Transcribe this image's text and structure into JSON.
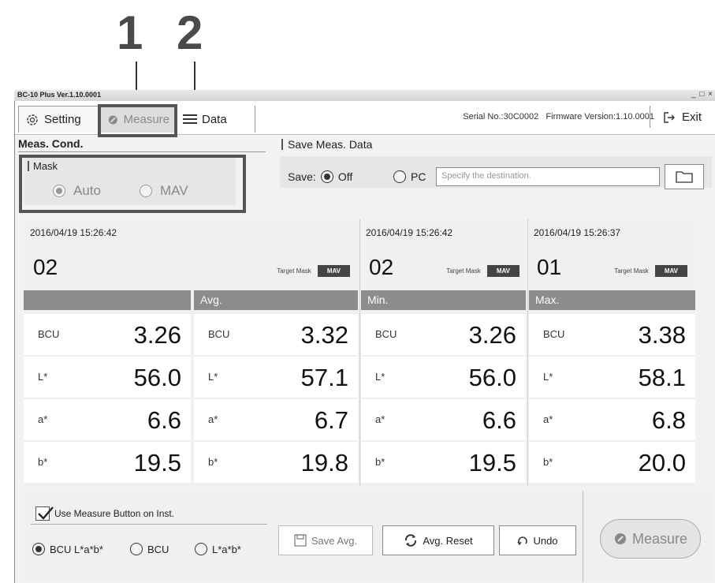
{
  "callouts": [
    "1",
    "2"
  ],
  "window": {
    "title": "BC-10 Plus Ver.1.10.0001",
    "controls": "_ □ ×"
  },
  "toolbar": {
    "setting_label": "Setting",
    "measure_label": "Measure",
    "data_label": "Data",
    "serial": "Serial No.:30C0002",
    "firmware": "Firmware Version:1.10.0001",
    "exit_label": "Exit"
  },
  "meas_cond": {
    "title": "Meas. Cond.",
    "mask_label": "Mask",
    "options": [
      "Auto",
      "MAV"
    ],
    "selected": "Auto"
  },
  "save_data": {
    "title": "Save Meas. Data",
    "save_label": "Save:",
    "off_label": "Off",
    "pc_label": "PC",
    "dest_placeholder": "Specify the destination.",
    "selected": "Off"
  },
  "columns": [
    {
      "timestamp": "2016/04/19 15:26:42",
      "number": "02",
      "target_label": "Target Mask",
      "target_value": "MAV",
      "header": "",
      "rows": [
        {
          "label": "BCU",
          "value": "3.26"
        },
        {
          "label": "L*",
          "value": "56.0"
        },
        {
          "label": "a*",
          "value": "6.6"
        },
        {
          "label": "b*",
          "value": "19.5"
        }
      ]
    },
    {
      "header": "Avg.",
      "rows": [
        {
          "label": "BCU",
          "value": "3.32"
        },
        {
          "label": "L*",
          "value": "57.1"
        },
        {
          "label": "a*",
          "value": "6.7"
        },
        {
          "label": "b*",
          "value": "19.8"
        }
      ]
    },
    {
      "timestamp": "2016/04/19 15:26:42",
      "number": "02",
      "target_label": "Target Mask",
      "target_value": "MAV",
      "header": "Min.",
      "rows": [
        {
          "label": "BCU",
          "value": "3.26"
        },
        {
          "label": "L*",
          "value": "56.0"
        },
        {
          "label": "a*",
          "value": "6.6"
        },
        {
          "label": "b*",
          "value": "19.5"
        }
      ]
    },
    {
      "timestamp": "2016/04/19 15:26:37",
      "number": "01",
      "target_label": "Target Mask",
      "target_value": "MAV",
      "header": "Max.",
      "rows": [
        {
          "label": "BCU",
          "value": "3.38"
        },
        {
          "label": "L*",
          "value": "58.1"
        },
        {
          "label": "a*",
          "value": "6.8"
        },
        {
          "label": "b*",
          "value": "20.0"
        }
      ]
    }
  ],
  "bottom": {
    "use_button_label": "Use Measure Button on Inst.",
    "use_button_checked": true,
    "modes": [
      "BCU L*a*b*",
      "BCU",
      "L*a*b*"
    ],
    "selected_mode": "BCU L*a*b*",
    "save_avg_label": "Save Avg.",
    "avg_reset_label": "Avg. Reset",
    "undo_label": "Undo",
    "measure_label": "Measure"
  },
  "colors": {
    "header_gray": "#8c8c8c",
    "mav_badge": "#444444",
    "callout": "#555555"
  }
}
